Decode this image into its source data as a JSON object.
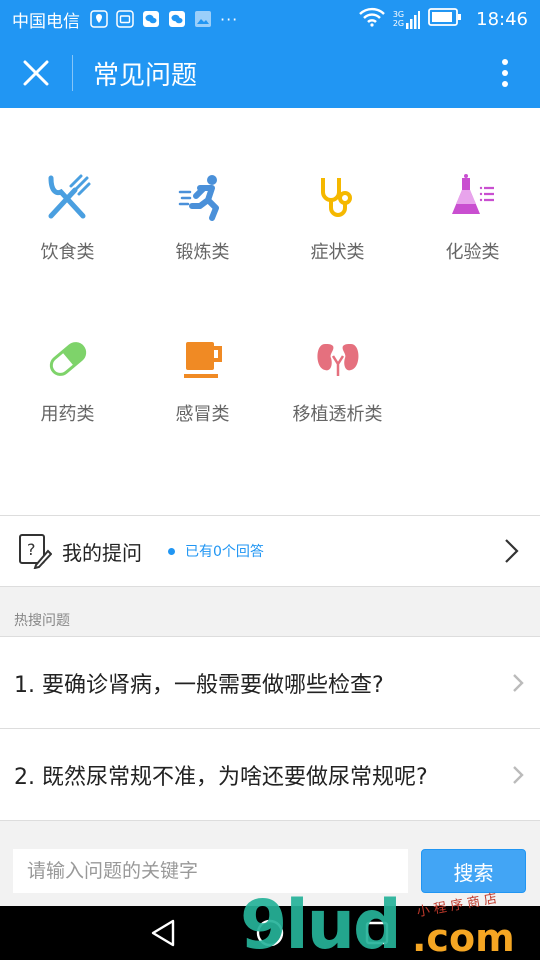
{
  "status_bar": {
    "carrier": "中国电信",
    "time": "18:46",
    "overflow": "···",
    "network_top": "3G",
    "network_bottom": "2G"
  },
  "app_bar": {
    "title": "常见问题"
  },
  "categories": [
    {
      "label": "饮食类",
      "icon": "fork-knife-icon",
      "color": "#4a9fe0"
    },
    {
      "label": "锻炼类",
      "icon": "running-icon",
      "color": "#4a90d9"
    },
    {
      "label": "症状类",
      "icon": "stethoscope-icon",
      "color": "#f5b800"
    },
    {
      "label": "化验类",
      "icon": "flask-icon",
      "color": "#c94fd0"
    },
    {
      "label": "用药类",
      "icon": "pill-icon",
      "color": "#7ed36a"
    },
    {
      "label": "感冒类",
      "icon": "cup-icon",
      "color": "#f08a24"
    },
    {
      "label": "移植透析类",
      "icon": "kidney-icon",
      "color": "#e5707e"
    }
  ],
  "my_questions": {
    "label": "我的提问",
    "answers": "已有0个回答"
  },
  "hot": {
    "title": "热搜问题",
    "items": [
      "1. 要确诊肾病，一般需要做哪些检查?",
      "2. 既然尿常规不准，为啥还要做尿常规呢?"
    ]
  },
  "search": {
    "placeholder": "请输入问题的关键字",
    "button": "搜索"
  },
  "watermark": {
    "brand": "9lud",
    "tld": ".com",
    "tagline": "小程序商店"
  },
  "colors": {
    "primary": "#2196f3",
    "button": "#42a5f5"
  }
}
